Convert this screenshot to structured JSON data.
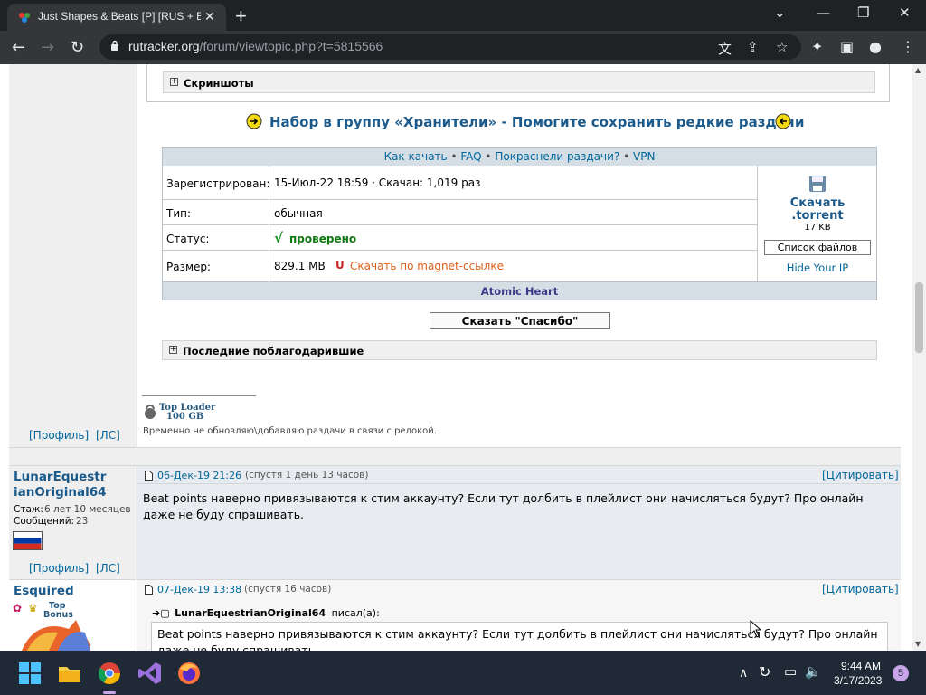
{
  "browser": {
    "tab_title": "Just Shapes & Beats [P] [RUS + E",
    "url_host": "rutracker.org",
    "url_path": "/forum/viewtopic.php?t=5815566"
  },
  "content": {
    "screenshots_label": "Скриншоты",
    "recruit_text": "Набор в группу «Хранители» - Помогите сохранить редкие раздачи",
    "top_links": [
      "Как качать",
      "FAQ",
      "Покраснели раздачи?",
      "VPN"
    ],
    "rows": [
      {
        "label": "Зарегистрирован:",
        "value": "15-Июл-22 18:59 · Скачан: 1,019 раз"
      },
      {
        "label": "Тип:",
        "value": "обычная"
      },
      {
        "label": "Статус:",
        "value": "проверено"
      },
      {
        "label": "Размер:",
        "value": "829.1 MB",
        "magnet": "Скачать по magnet-ссылке"
      }
    ],
    "download": {
      "label1": "Скачать",
      "label2": ".torrent",
      "size": "17 KB",
      "files_button": "Список файлов",
      "hide_ip": "Hide Your IP"
    },
    "atomic": "Atomic Heart",
    "thanks_button": "Сказать \"Спасибо\"",
    "last_thanked": "Последние поблагодарившие",
    "badge_top": "Top Loader",
    "badge_bottom": "100 GB",
    "signature": "Временно не обновляю\\добавляю раздачи в связи с релокой.",
    "profile_link": "[Профиль]",
    "pm_link": "[ЛС]"
  },
  "post1": {
    "username1": "LunarEquestr",
    "username2": "ianOriginal64",
    "stage_label": "Стаж:",
    "stage_value": "6 лет 10 месяцев",
    "messages_label": "Сообщений:",
    "messages_value": "23",
    "date": "06-Дек-19 21:26",
    "after": "(спустя 1 день 13 часов)",
    "quote_link": "[Цитировать]",
    "text": "Beat points наверно привязываются к стим аккаунту? Если тут долбить в плейлист они начисляться будут? Про онлайн даже не буду спрашивать."
  },
  "post2": {
    "username": "Esquired",
    "badge1": "Top",
    "badge2": "Bonus",
    "date": "07-Дек-19 13:38",
    "after": "(спустя 16 часов)",
    "quote_link": "[Цитировать]",
    "quote_author": "LunarEquestrianOriginal64",
    "quote_wrote": "писал(а):",
    "quote_text": "Beat points наверно привязываются к стим аккаунту? Если тут долбить в плейлист они начисляться будут? Про онлайн даже не буду спрашивать."
  },
  "taskbar": {
    "time": "9:44 AM",
    "date": "3/17/2023",
    "notif": "5"
  }
}
